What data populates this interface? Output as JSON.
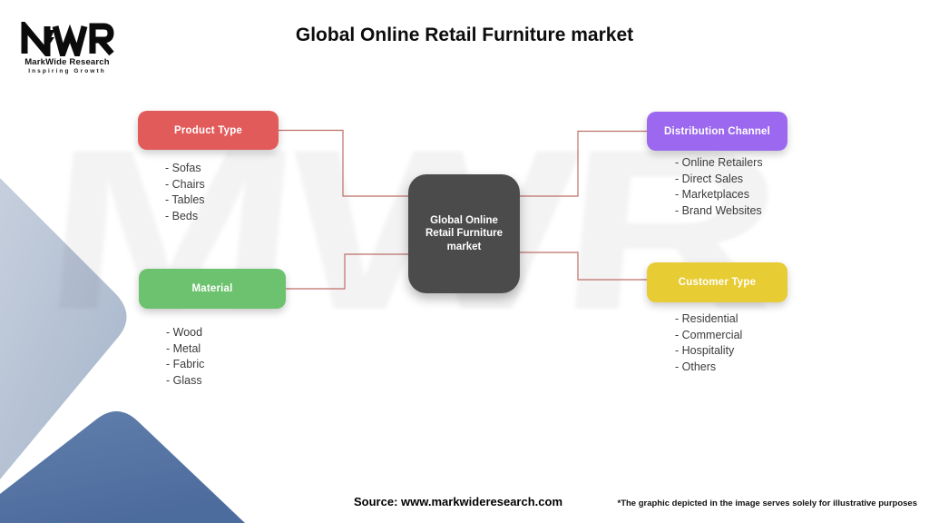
{
  "title": "Global Online Retail Furniture market",
  "logo": {
    "mark": "MWR",
    "name": "MarkWide Research",
    "tagline": "Inspiring Growth"
  },
  "watermark": "MWR",
  "center_node": {
    "label": "Global Online Retail Furniture market",
    "color": "#4b4b4b"
  },
  "nodes": [
    {
      "label": "Product Type",
      "color": "#e25b5b",
      "items": [
        "- Sofas",
        "- Chairs",
        "- Tables",
        "- Beds"
      ]
    },
    {
      "label": "Distribution Channel",
      "color": "#9b68ef",
      "items": [
        "- Online Retailers",
        "- Direct Sales",
        "- Marketplaces",
        "- Brand Websites"
      ]
    },
    {
      "label": "Material",
      "color": "#6cc26e",
      "items": [
        "- Wood",
        "- Metal",
        "- Fabric",
        "- Glass"
      ]
    },
    {
      "label": "Customer Type",
      "color": "#e8cc33",
      "items": [
        "- Residential",
        "- Commercial",
        "- Hospitality",
        "- Others"
      ]
    }
  ],
  "footer": {
    "source": "Source: www.markwideresearch.com",
    "disclaimer": "*The graphic depicted in the image serves solely for illustrative purposes"
  },
  "colors": {
    "connector": "#bd6f67",
    "decor_light_top": "#c6cfdd",
    "decor_light_bottom": "#a6b5cb",
    "decor_dark_top": "#617fab",
    "decor_dark_bottom": "#4d6c9e"
  }
}
